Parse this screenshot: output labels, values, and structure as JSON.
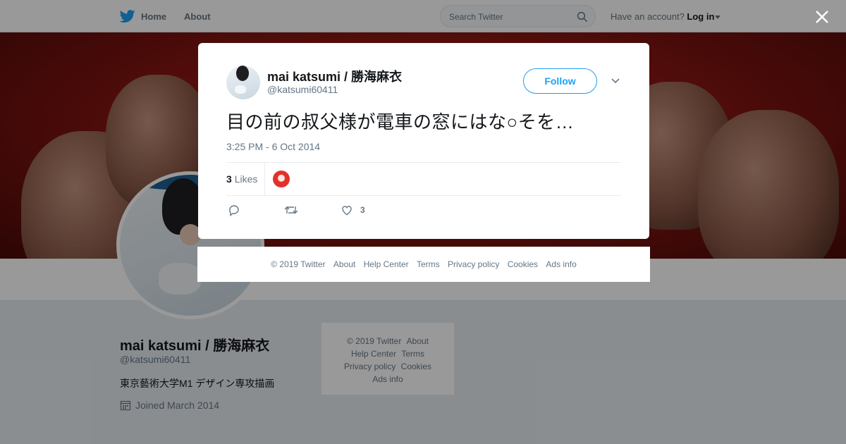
{
  "nav": {
    "home": "Home",
    "about": "About",
    "search_placeholder": "Search Twitter",
    "account_prompt": "Have an account?",
    "login": "Log in"
  },
  "profile": {
    "name": "mai katsumi / 勝海麻衣",
    "handle": "@katsumi60411",
    "bio": "東京藝術大学M1 デザイン専攻描画",
    "joined": "Joined March 2014"
  },
  "side_footer": {
    "copyright": "© 2019 Twitter",
    "about": "About",
    "help": "Help Center",
    "terms": "Terms",
    "privacy": "Privacy policy",
    "cookies": "Cookies",
    "ads": "Ads info"
  },
  "tweet": {
    "name": "mai katsumi / 勝海麻衣",
    "handle": "@katsumi60411",
    "follow_label": "Follow",
    "text": "目の前の叔父様が電車の窓にはな○そを…",
    "timestamp": "3:25 PM - 6 Oct 2014",
    "likes_count": "3",
    "likes_label": "Likes",
    "like_action_count": "3"
  },
  "modal_footer": {
    "copyright": "© 2019 Twitter",
    "about": "About",
    "help": "Help Center",
    "terms": "Terms",
    "privacy": "Privacy policy",
    "cookies": "Cookies",
    "ads": "Ads info"
  },
  "colors": {
    "brand": "#1da1f2",
    "banner": "#8a1612",
    "text_secondary": "#657786"
  }
}
